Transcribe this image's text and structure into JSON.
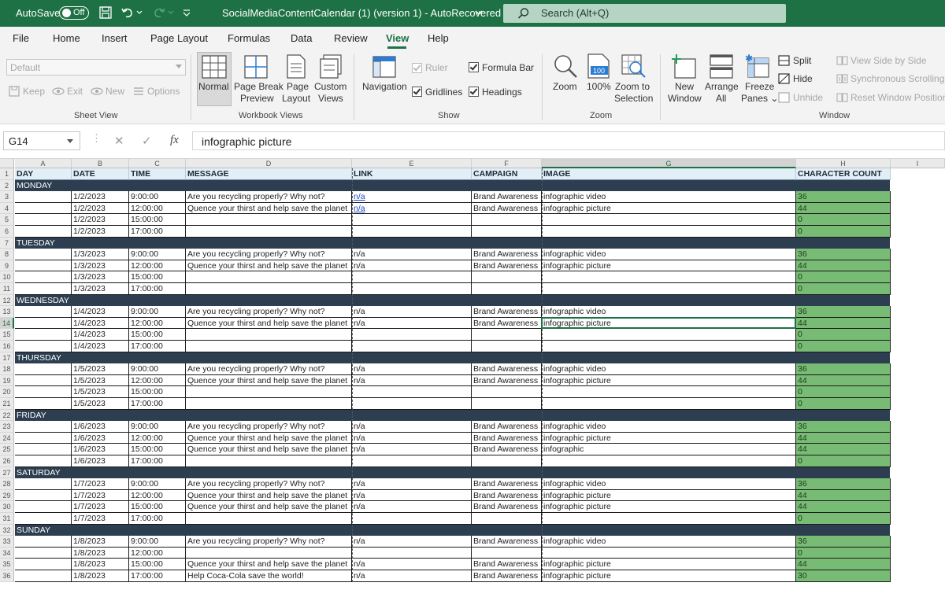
{
  "titlebar": {
    "autosave_label": "AutoSave",
    "toggle_state": "Off",
    "doc_title": "SocialMediaContentCalendar (1) (version 1)  -  AutoRecovered",
    "search_placeholder": "Search (Alt+Q)"
  },
  "menu": [
    "File",
    "Home",
    "Insert",
    "Page Layout",
    "Formulas",
    "Data",
    "Review",
    "View",
    "Help"
  ],
  "active_tab": "View",
  "ribbon": {
    "sheet_view": {
      "combo_value": "Default",
      "keep": "Keep",
      "exit": "Exit",
      "new": "New",
      "options": "Options",
      "group_label": "Sheet View"
    },
    "workbook_views": {
      "normal": "Normal",
      "page_break_1": "Page Break",
      "page_break_2": "Preview",
      "page_layout_1": "Page",
      "page_layout_2": "Layout",
      "custom_1": "Custom",
      "custom_2": "Views",
      "group_label": "Workbook Views"
    },
    "show": {
      "navigation": "Navigation",
      "ruler": "Ruler",
      "gridlines": "Gridlines",
      "formula_bar": "Formula Bar",
      "headings": "Headings",
      "group_label": "Show"
    },
    "zoom": {
      "zoom": "Zoom",
      "hundred": "100%",
      "hundred_icon_text": "100",
      "zoom_sel_1": "Zoom to",
      "zoom_sel_2": "Selection",
      "group_label": "Zoom"
    },
    "window": {
      "new_1": "New",
      "new_2": "Window",
      "arrange_1": "Arrange",
      "arrange_2": "All",
      "freeze_1": "Freeze",
      "freeze_2": "Panes ⌄",
      "split": "Split",
      "hide": "Hide",
      "unhide": "Unhide",
      "side_by_side": "View Side by Side",
      "sync_scroll": "Synchronous Scrolling",
      "reset_pos": "Reset Window Position",
      "group_label": "Window"
    }
  },
  "formula_bar": {
    "name_box": "G14",
    "cancel": "✕",
    "enter": "✓",
    "fx": "fx",
    "content": "infographic picture"
  },
  "grid": {
    "columns": [
      "A",
      "B",
      "C",
      "D",
      "E",
      "F",
      "G",
      "H",
      "I"
    ],
    "selected_column": "G",
    "selected_row": 14,
    "headers": [
      "DAY",
      "DATE",
      "TIME",
      "MESSAGE",
      "LINK",
      "CAMPAIGN",
      "IMAGE",
      "CHARACTER COUNT"
    ],
    "rows": [
      {
        "n": 2,
        "type": "day",
        "day": "MONDAY"
      },
      {
        "n": 3,
        "type": "data",
        "date": "1/2/2023",
        "time": "9:00:00",
        "message": "Are you recycling properly? Why not?",
        "link": "n/a",
        "link_style": "hyperlink",
        "campaign": "Brand Awareness",
        "image": "infographic video",
        "count": "36"
      },
      {
        "n": 4,
        "type": "data",
        "date": "1/2/2023",
        "time": "12:00:00",
        "message": "Quence your thirst and help save the planet",
        "link": "n/a",
        "link_style": "hyperlink",
        "campaign": "Brand Awareness",
        "image": "infographic picture",
        "count": "44"
      },
      {
        "n": 5,
        "type": "data",
        "date": "1/2/2023",
        "time": "15:00:00",
        "message": "",
        "link": "",
        "campaign": "",
        "image": "",
        "count": "0"
      },
      {
        "n": 6,
        "type": "data",
        "date": "1/2/2023",
        "time": "17:00:00",
        "message": "",
        "link": "",
        "campaign": "",
        "image": "",
        "count": "0"
      },
      {
        "n": 7,
        "type": "day",
        "day": "TUESDAY"
      },
      {
        "n": 8,
        "type": "data",
        "date": "1/3/2023",
        "time": "9:00:00",
        "message": "Are you recycling properly? Why not?",
        "link": "n/a",
        "campaign": "Brand Awareness",
        "image": "infographic video",
        "count": "36"
      },
      {
        "n": 9,
        "type": "data",
        "date": "1/3/2023",
        "time": "12:00:00",
        "message": "Quence your thirst and help save the planet",
        "link": "n/a",
        "campaign": "Brand Awareness",
        "image": "infographic picture",
        "count": "44"
      },
      {
        "n": 10,
        "type": "data",
        "date": "1/3/2023",
        "time": "15:00:00",
        "message": "",
        "link": "",
        "campaign": "",
        "image": "",
        "count": "0"
      },
      {
        "n": 11,
        "type": "data",
        "date": "1/3/2023",
        "time": "17:00:00",
        "message": "",
        "link": "",
        "campaign": "",
        "image": "",
        "count": "0"
      },
      {
        "n": 12,
        "type": "day",
        "day": "WEDNESDAY"
      },
      {
        "n": 13,
        "type": "data",
        "date": "1/4/2023",
        "time": "9:00:00",
        "message": "Are you recycling properly? Why not?",
        "link": "n/a",
        "campaign": "Brand Awareness",
        "image": "infographic video",
        "count": "36"
      },
      {
        "n": 14,
        "type": "data",
        "date": "1/4/2023",
        "time": "12:00:00",
        "message": "Quence your thirst and help save the planet",
        "link": "n/a",
        "campaign": "Brand Awareness",
        "image": "infographic picture",
        "count": "44"
      },
      {
        "n": 15,
        "type": "data",
        "date": "1/4/2023",
        "time": "15:00:00",
        "message": "",
        "link": "",
        "campaign": "",
        "image": "",
        "count": "0"
      },
      {
        "n": 16,
        "type": "data",
        "date": "1/4/2023",
        "time": "17:00:00",
        "message": "",
        "link": "",
        "campaign": "",
        "image": "",
        "count": "0"
      },
      {
        "n": 17,
        "type": "day",
        "day": "THURSDAY"
      },
      {
        "n": 18,
        "type": "data",
        "date": "1/5/2023",
        "time": "9:00:00",
        "message": "Are you recycling properly? Why not?",
        "link": "n/a",
        "campaign": "Brand Awareness",
        "image": "infographic video",
        "count": "36"
      },
      {
        "n": 19,
        "type": "data",
        "date": "1/5/2023",
        "time": "12:00:00",
        "message": "Quence your thirst and help save the planet",
        "link": "n/a",
        "campaign": "Brand Awareness",
        "image": "infographic picture",
        "count": "44"
      },
      {
        "n": 20,
        "type": "data",
        "date": "1/5/2023",
        "time": "15:00:00",
        "message": "",
        "link": "",
        "campaign": "",
        "image": "",
        "count": "0"
      },
      {
        "n": 21,
        "type": "data",
        "date": "1/5/2023",
        "time": "17:00:00",
        "message": "",
        "link": "",
        "campaign": "",
        "image": "",
        "count": "0"
      },
      {
        "n": 22,
        "type": "day",
        "day": "FRIDAY"
      },
      {
        "n": 23,
        "type": "data",
        "date": "1/6/2023",
        "time": "9:00:00",
        "message": "Are you recycling properly? Why not?",
        "link": "n/a",
        "campaign": "Brand Awareness",
        "image": "infographic video",
        "count": "36"
      },
      {
        "n": 24,
        "type": "data",
        "date": "1/6/2023",
        "time": "12:00:00",
        "message": "Quence your thirst and help save the planet",
        "link": "n/a",
        "campaign": "Brand Awareness",
        "image": "infographic picture",
        "count": "44"
      },
      {
        "n": 25,
        "type": "data",
        "date": "1/6/2023",
        "time": "15:00:00",
        "message": "Quence your thirst and help save the planet",
        "link": "n/a",
        "campaign": "Brand Awareness",
        "image": "infographic",
        "count": "44"
      },
      {
        "n": 26,
        "type": "data",
        "date": "1/6/2023",
        "time": "17:00:00",
        "message": "",
        "link": "",
        "campaign": "",
        "image": "",
        "count": "0"
      },
      {
        "n": 27,
        "type": "day",
        "day": "SATURDAY"
      },
      {
        "n": 28,
        "type": "data",
        "date": "1/7/2023",
        "time": "9:00:00",
        "message": "Are you recycling properly? Why not?",
        "link": "n/a",
        "campaign": "Brand Awareness",
        "image": "infographic video",
        "count": "36"
      },
      {
        "n": 29,
        "type": "data",
        "date": "1/7/2023",
        "time": "12:00:00",
        "message": "Quence your thirst and help save the planet",
        "link": "n/a",
        "campaign": "Brand Awareness",
        "image": "infographic picture",
        "count": "44"
      },
      {
        "n": 30,
        "type": "data",
        "date": "1/7/2023",
        "time": "15:00:00",
        "message": "Quence your thirst and help save the planet",
        "link": "n/a",
        "campaign": "Brand Awareness",
        "image": "infographic picture",
        "count": "44"
      },
      {
        "n": 31,
        "type": "data",
        "date": "1/7/2023",
        "time": "17:00:00",
        "message": "",
        "link": "",
        "campaign": "",
        "image": "",
        "count": "0"
      },
      {
        "n": 32,
        "type": "day",
        "day": "SUNDAY"
      },
      {
        "n": 33,
        "type": "data",
        "date": "1/8/2023",
        "time": "9:00:00",
        "message": "Are you recycling properly? Why not?",
        "link": "n/a",
        "campaign": "Brand Awareness",
        "image": "infographic video",
        "count": "36"
      },
      {
        "n": 34,
        "type": "data",
        "date": "1/8/2023",
        "time": "12:00:00",
        "message": "",
        "link": "",
        "campaign": "",
        "image": "",
        "count": "0"
      },
      {
        "n": 35,
        "type": "data",
        "date": "1/8/2023",
        "time": "15:00:00",
        "message": "Quence your thirst and help save the planet",
        "link": "n/a",
        "campaign": "Brand Awareness",
        "image": "infographic picture",
        "count": "44"
      },
      {
        "n": 36,
        "type": "data",
        "date": "1/8/2023",
        "time": "17:00:00",
        "message": "Help Coca-Cola save the world!",
        "link": "n/a",
        "campaign": "Brand Awareness",
        "image": "infographic picture",
        "count": "30"
      }
    ]
  },
  "colors": {
    "brand_green": "#1e7145",
    "day_band": "#2c3e50",
    "header_fill": "#e2eff7",
    "count_fill": "#77bb74",
    "hyperlink": "#1f49c9"
  }
}
